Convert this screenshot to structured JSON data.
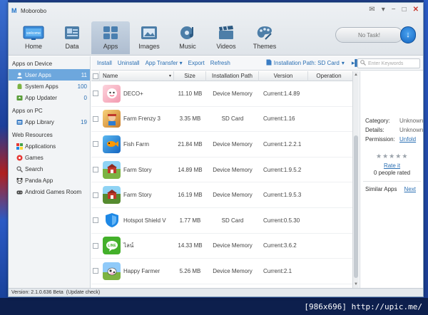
{
  "window": {
    "title": "Moborobo"
  },
  "nav": [
    {
      "label": "Home",
      "icon": "welcome-screen-icon"
    },
    {
      "label": "Data",
      "icon": "contacts-card-icon"
    },
    {
      "label": "Apps",
      "icon": "apps-grid-icon",
      "active": true
    },
    {
      "label": "Images",
      "icon": "image-frame-icon"
    },
    {
      "label": "Music",
      "icon": "music-disc-icon"
    },
    {
      "label": "Videos",
      "icon": "clapperboard-icon"
    },
    {
      "label": "Themes",
      "icon": "palette-icon"
    }
  ],
  "task": {
    "label": "No Task!"
  },
  "sidebar": {
    "device_header": "Apps on Device",
    "device_items": [
      {
        "label": "User Apps",
        "count": "11",
        "active": true
      },
      {
        "label": "System Apps",
        "count": "100"
      },
      {
        "label": "App Updater",
        "count": "0"
      }
    ],
    "pc_header": "Apps on PC",
    "pc_items": [
      {
        "label": "App Library",
        "count": "19"
      }
    ],
    "web_header": "Web Resources",
    "web_items": [
      {
        "label": "Applications"
      },
      {
        "label": "Games"
      },
      {
        "label": "Search"
      },
      {
        "label": "Panda App"
      },
      {
        "label": "Android Games Room"
      }
    ]
  },
  "toolbar": {
    "install": "Install",
    "uninstall": "Uninstall",
    "transfer": "App Transfer",
    "export": "Export",
    "refresh": "Refresh",
    "path": "Installation Path: SD Card",
    "search_placeholder": "Enter Keywords"
  },
  "table": {
    "headers": {
      "name": "Name",
      "size": "Size",
      "path": "Installation Path",
      "version": "Version",
      "operation": "Operation"
    },
    "rows": [
      {
        "name": "DECO+",
        "size": "11.10 MB",
        "path": "Device Memory",
        "version": "Current:1.4.89",
        "icon_color": "#f6b8c6"
      },
      {
        "name": "Farm Frenzy 3",
        "size": "3.35 MB",
        "path": "SD Card",
        "version": "Current:1.16",
        "icon_color": "#e0a64a"
      },
      {
        "name": "Fish Farm",
        "size": "21.84 MB",
        "path": "Device Memory",
        "version": "Current:1.2.2.1",
        "icon_color": "#2f8fd6"
      },
      {
        "name": "Farm Story",
        "size": "14.89 MB",
        "path": "Device Memory",
        "version": "Current:1.9.5.2",
        "icon_color": "#7cb342"
      },
      {
        "name": "Farm Story",
        "size": "16.19 MB",
        "path": "Device Memory",
        "version": "Current:1.9.5.3",
        "icon_color": "#689f38"
      },
      {
        "name": "Hotspot Shield V",
        "size": "1.77 MB",
        "path": "SD Card",
        "version": "Current:0.5.30",
        "icon_color": "#1e88e5"
      },
      {
        "name": "ไลน์",
        "size": "14.33 MB",
        "path": "Device Memory",
        "version": "Current:3.6.2",
        "icon_color": "#43b02a"
      },
      {
        "name": "Happy Farmer",
        "size": "5.26 MB",
        "path": "Device Memory",
        "version": "Current:2.1",
        "icon_color": "#64b5f6"
      }
    ]
  },
  "details": {
    "category_k": "Category:",
    "category_v": "Unknown",
    "details_k": "Details:",
    "details_v": "Unknown",
    "permission_k": "Permission:",
    "permission_v": "Unfold",
    "rate": "Rate it",
    "rated": "0 people rated",
    "similar": "Similar Apps",
    "next": "Next"
  },
  "status": {
    "version": "Version: 2.1.0.636 Beta",
    "update": "(Update check)"
  },
  "watermark": "[986x696] http://upic.me/"
}
